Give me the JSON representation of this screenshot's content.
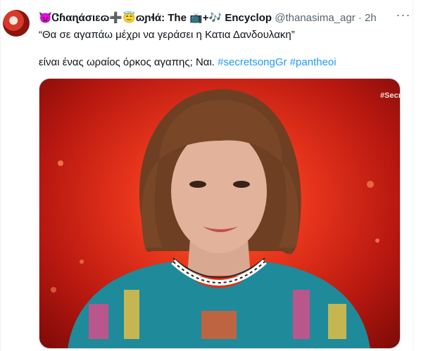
{
  "tweet": {
    "author_name": "😈Ꮳɦαɳάσιɛɷ➕😇ɷɲɬά: The 📺+🎶 Encyclop",
    "handle": "@thanasima_agr",
    "separator": "·",
    "time": "2h",
    "more_icon": "more-options-icon",
    "quote_text": "“Θα σε αγαπάω μέχρι να γεράσει η Κατια Δανδουλακη”",
    "body_text": "είναι ένας ωραίος όρκος αγαπης; Ναι.",
    "hashtags": [
      "#secretsongGr",
      "#pantheoi"
    ],
    "media": {
      "watermark": "#Secr"
    }
  }
}
